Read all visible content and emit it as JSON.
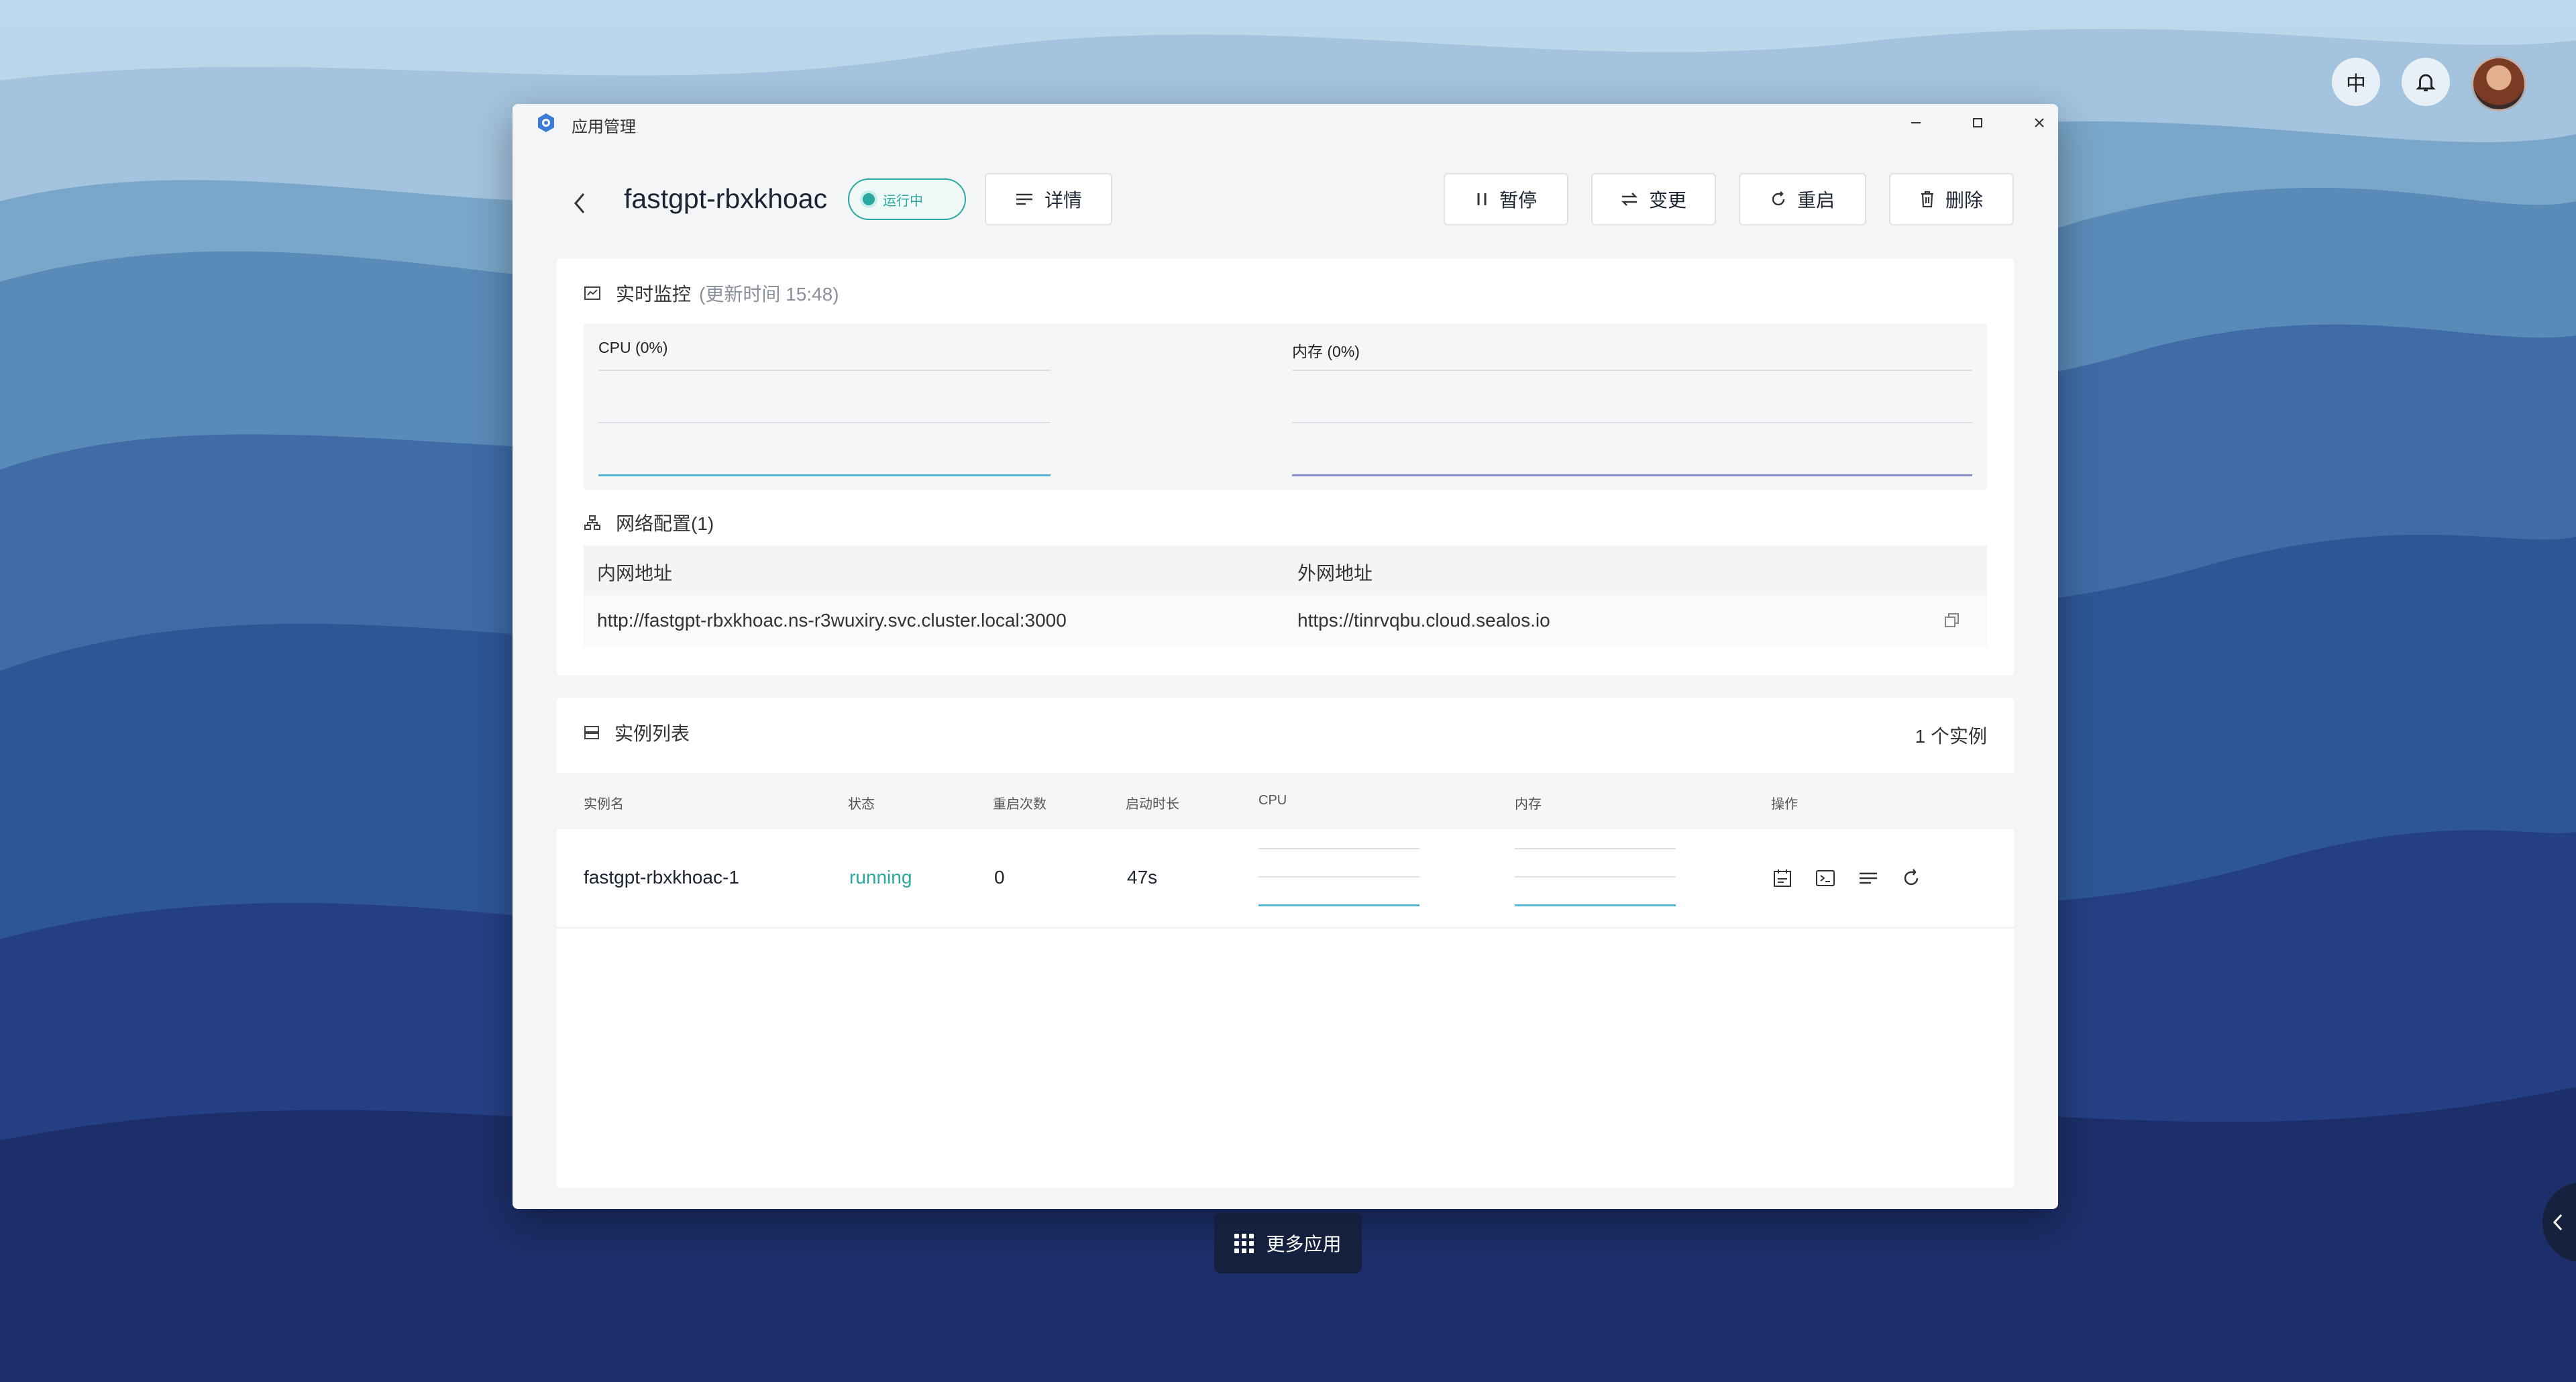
{
  "colors": {
    "accent": "#2aa7a0",
    "cpu_line": "#56b8d6",
    "mem_line": "#8a8ec9"
  },
  "tray": {
    "lang": "中"
  },
  "window": {
    "title": "应用管理"
  },
  "header": {
    "app_name": "fastgpt-rbxkhoac",
    "status": "运行中",
    "details_label": "详情",
    "pause_label": "暂停",
    "change_label": "变更",
    "restart_label": "重启",
    "delete_label": "删除"
  },
  "monitor": {
    "title": "实时监控",
    "updated": "(更新时间  15:48)",
    "cpu_label": "CPU  (0%)",
    "mem_label": "内存  (0%)",
    "cpu_percent": 0,
    "mem_percent": 0
  },
  "network": {
    "title": "网络配置(1)",
    "col_internal": "内网地址",
    "col_external": "外网地址",
    "internal": "http://fastgpt-rbxkhoac.ns-r3wuxiry.svc.cluster.local:3000",
    "external": "https://tinrvqbu.cloud.sealos.io"
  },
  "instances": {
    "title": "实例列表",
    "count": "1 个实例",
    "headers": [
      "实例名",
      "状态",
      "重启次数",
      "启动时长",
      "CPU",
      "内存",
      "操作"
    ],
    "rows": [
      {
        "name": "fastgpt-rbxkhoac-1",
        "status": "running",
        "restarts": "0",
        "uptime": "47s"
      }
    ]
  },
  "dock": {
    "label": "更多应用"
  }
}
